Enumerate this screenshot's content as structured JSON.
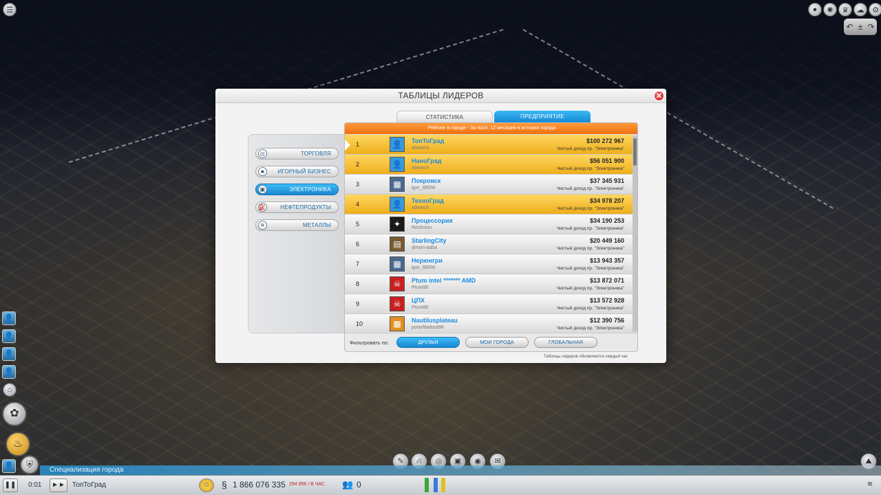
{
  "dialog": {
    "title": "ТАБЛИЦЫ ЛИДЕРОВ",
    "close": "✕",
    "tabs": {
      "stats": "СТАТИСТИКА",
      "enterprise": "ПРЕДПРИЯТИЕ"
    },
    "header": "Рейтинг в городе - За посл. 12 месяцев в истории города",
    "categories": [
      {
        "label": "ТОРГОВЛЯ",
        "icon": "◎"
      },
      {
        "label": "ИГОРНЫЙ БИЗНЕС",
        "icon": "♣"
      },
      {
        "label": "ЭЛЕКТРОНИКА",
        "icon": "▣"
      },
      {
        "label": "НЕФТЕПРОДУКТЫ",
        "icon": "⛽"
      },
      {
        "label": "МЕТАЛЛЫ",
        "icon": "≋"
      }
    ],
    "rows": [
      {
        "rank": "1",
        "city": "ТопТоГрад",
        "user": "a5earch",
        "amount": "$100 272 967",
        "note": "Чистый доход пр. \"Электроника\"",
        "avatar_icon": "👤"
      },
      {
        "rank": "2",
        "city": "НаноГрад",
        "user": "a5earch",
        "amount": "$56 051 900",
        "note": "Чистый доход пр. \"Электроника\"",
        "avatar_icon": "👤"
      },
      {
        "rank": "3",
        "city": "Покровск",
        "user": "igor_99DM",
        "amount": "$37 345 931",
        "note": "Чистый доход пр. \"Электроника\"",
        "avatar_icon": "▦"
      },
      {
        "rank": "4",
        "city": "ТехноГрад",
        "user": "a5earch",
        "amount": "$34 978 207",
        "note": "Чистый доход пр. \"Электроника\"",
        "avatar_icon": "👤"
      },
      {
        "rank": "5",
        "city": "Процессория",
        "user": "Reshvinn",
        "amount": "$34 190 253",
        "note": "Чистый доход пр. \"Электроника\"",
        "avatar_icon": "✦"
      },
      {
        "rank": "6",
        "city": "StarlingCity",
        "user": "dimon-aaba",
        "amount": "$20 449 160",
        "note": "Чистый доход пр. \"Электроника\"",
        "avatar_icon": "▤"
      },
      {
        "rank": "7",
        "city": "Нерюнгри",
        "user": "igor_99DM",
        "amount": "$13 943 357",
        "note": "Чистый доход пр. \"Электроника\"",
        "avatar_icon": "▦"
      },
      {
        "rank": "8",
        "city": "Ptum intel ******* AMD",
        "user": "Ptum88",
        "amount": "$13 872 071",
        "note": "Чистый доход пр. \"Электроника\"",
        "avatar_icon": "☠"
      },
      {
        "rank": "9",
        "city": "ЦПХ",
        "user": "Ptum88",
        "amount": "$13 572 928",
        "note": "Чистый доход пр. \"Электроника\"",
        "avatar_icon": "☠"
      },
      {
        "rank": "10",
        "city": "Nautilusplateau",
        "user": "potarfiladora98",
        "amount": "$12 390 756",
        "note": "Чистый доход пр. \"Электроника\"",
        "avatar_icon": "▩"
      }
    ],
    "filter": {
      "label": "Фильтровать по:",
      "friends": "ДРУЗЬЯ",
      "my_cities": "МОИ ГОРОДА",
      "global": "ГЛОБАЛЬНАЯ"
    },
    "footnote": "Таблицы лидеров обновляются каждый час"
  },
  "bottom": {
    "specialization": "Специализация города",
    "time": "0:01",
    "city_name": "ТопТоГрад",
    "money": "1 866 076 335",
    "income": "294 956 / В ЧАС",
    "population": "0"
  },
  "colors": {
    "accent": "#1c8be0",
    "highlight": "#f2b62a",
    "header": "#f07010"
  }
}
